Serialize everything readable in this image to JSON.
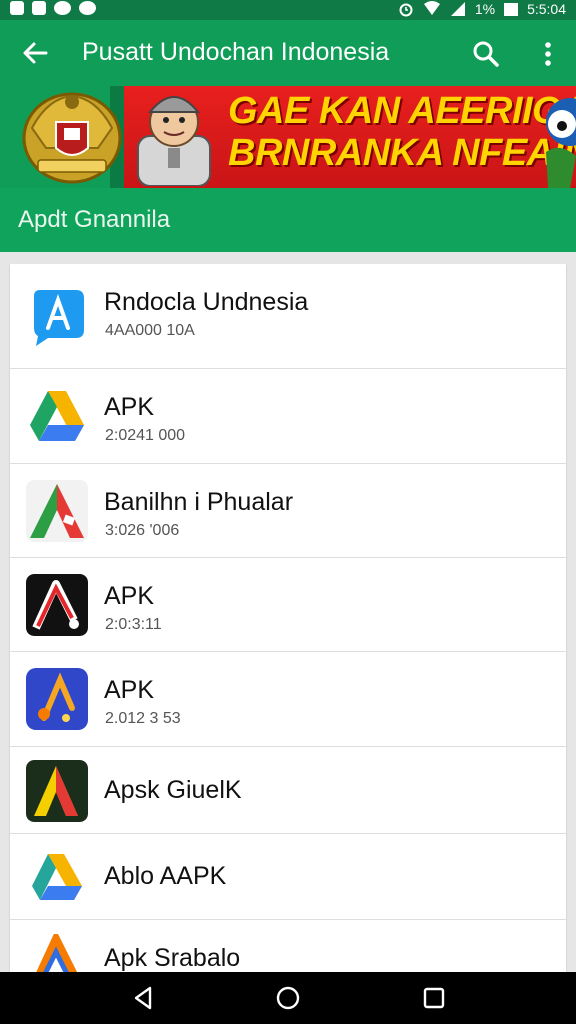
{
  "status_bar": {
    "battery": "1%",
    "time": "5:5:04"
  },
  "app_bar": {
    "title": "Pusatt Undochan Indonesia"
  },
  "banner": {
    "line1": "GAE KAN AEERIIGA",
    "line2": "BRNRANKA NFEAINI"
  },
  "section": {
    "label": "Apdt Gnannila"
  },
  "list": [
    {
      "name": "Rndocla Undnesia",
      "sub": "4AA000 10A",
      "icon": "blue-bubble-app-icon"
    },
    {
      "name": "APK",
      "sub": "2:0241 000",
      "icon": "drive-triangle-icon"
    },
    {
      "name": "Banilhn i Phualar",
      "sub": "3:026 '006",
      "icon": "red-green-a-icon"
    },
    {
      "name": "APK",
      "sub": "2:0:3:11",
      "icon": "black-red-a-icon"
    },
    {
      "name": "APK",
      "sub": "2.012 3 53",
      "icon": "blue-orange-a-icon"
    },
    {
      "name": "Apsk GiuelK",
      "sub": "",
      "icon": "yellow-red-a-icon"
    },
    {
      "name": "Ablo AAPK",
      "sub": "",
      "icon": "drive-color-icon"
    },
    {
      "name": "Apk Srabalo",
      "sub": "",
      "icon": "orange-a-icon"
    }
  ],
  "colors": {
    "primary": "#0f9d58",
    "status": "#0f7a45",
    "banner_red": "#e8201e",
    "banner_text": "#ffd400"
  }
}
